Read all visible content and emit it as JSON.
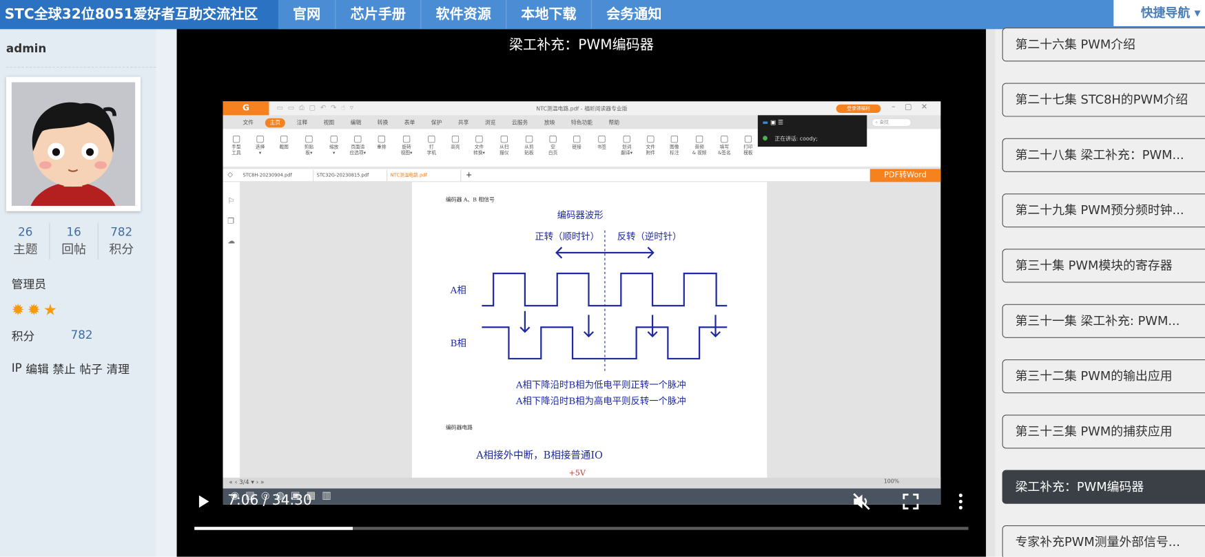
{
  "nav": {
    "brand": "STC全球32位8051爱好者互助交流社区",
    "items": [
      "官网",
      "芯片手册",
      "软件资源",
      "本地下载",
      "会务通知"
    ],
    "quick_nav": "快捷导航 ▾"
  },
  "user": {
    "name": "admin",
    "stats": [
      {
        "value": "26",
        "label": "主题"
      },
      {
        "value": "16",
        "label": "回帖"
      },
      {
        "value": "782",
        "label": "积分"
      }
    ],
    "role": "管理员",
    "stars": "✹✹★",
    "points_label": "积分",
    "points_value": "782",
    "admin_links": [
      "IP",
      "编辑",
      "禁止",
      "帖子",
      "清理"
    ]
  },
  "video": {
    "title": "梁工补充：PWM编码器",
    "time": "7:06 / 34:30",
    "progress_fraction": 0.2048,
    "muted": true
  },
  "episodes": [
    {
      "label": "第二十六集 PWM介绍",
      "active": false
    },
    {
      "label": "第二十七集 STC8H的PWM介绍",
      "active": false
    },
    {
      "label": "第二十八集 梁工补充：PWM...",
      "active": false
    },
    {
      "label": "第二十九集 PWM预分频时钟...",
      "active": false
    },
    {
      "label": "第三十集 PWM模块的寄存器",
      "active": false
    },
    {
      "label": "第三十一集 梁工补充: PWM...",
      "active": false
    },
    {
      "label": "第三十二集 PWM的输出应用",
      "active": false
    },
    {
      "label": "第三十三集 PWM的捕获应用",
      "active": false
    },
    {
      "label": "梁工补充：PWM编码器",
      "active": true
    },
    {
      "label": "专家补充PWM测量外部信号...",
      "active": false
    }
  ],
  "frame": {
    "window_title": "NTC测温电路.pdf - 福昕阅读器专业版",
    "login": "登录领福利",
    "menu": [
      "文件",
      "主页",
      "注释",
      "视图",
      "编辑",
      "转换",
      "表单",
      "保护",
      "共享",
      "浏览",
      "云服务",
      "放映",
      "特色功能",
      "帮助"
    ],
    "menu_active": 1,
    "search_placeholder": "查找",
    "tools": [
      "手型\n工具",
      "选择\n▾",
      "截图",
      "剪贴\n板▾",
      "缩放\n▾",
      "页面适\n应选项▾",
      "重排",
      "旋转\n视图▾",
      "打\n字机",
      "高亮",
      "文件\n转换▾",
      "从扫\n描仪",
      "从剪\n贴板",
      "空\n白页",
      "链接",
      "书签",
      "划词\n翻译▾",
      "文件\n附件",
      "图像\n标注",
      "音频\n& 视频",
      "填写\n&签名",
      "打印\n模板"
    ],
    "tabs": [
      "STC8H-20230904.pdf",
      "STC32G-20230815.pdf",
      "NTC测温电路.pdf"
    ],
    "tab_active": 2,
    "pdf_to_word": "PDF转Word",
    "speaker": "正在讲话: coody;",
    "page_indicator": "3/4",
    "zoom": "100%",
    "doc": {
      "section1": "编码器 A、B 相信号",
      "wave_title": "编码器波形",
      "forward": "正转（顺时针）",
      "reverse": "反转（逆时针）",
      "phase_a": "A相",
      "phase_b": "B相",
      "rule1": "A相下降沿时B相为低电平则正转一个脉冲",
      "rule2": "A相下降沿时B相为高电平则反转一个脉冲",
      "section2": "编码器电路",
      "circuit_note": "A相接外中断，B相接普通IO",
      "vcc": "+5V"
    }
  },
  "colors": {
    "nav": "#4b8dd4",
    "brand": "#2b73c2",
    "accent": "#f5821f",
    "wave": "#1f2aa0"
  }
}
